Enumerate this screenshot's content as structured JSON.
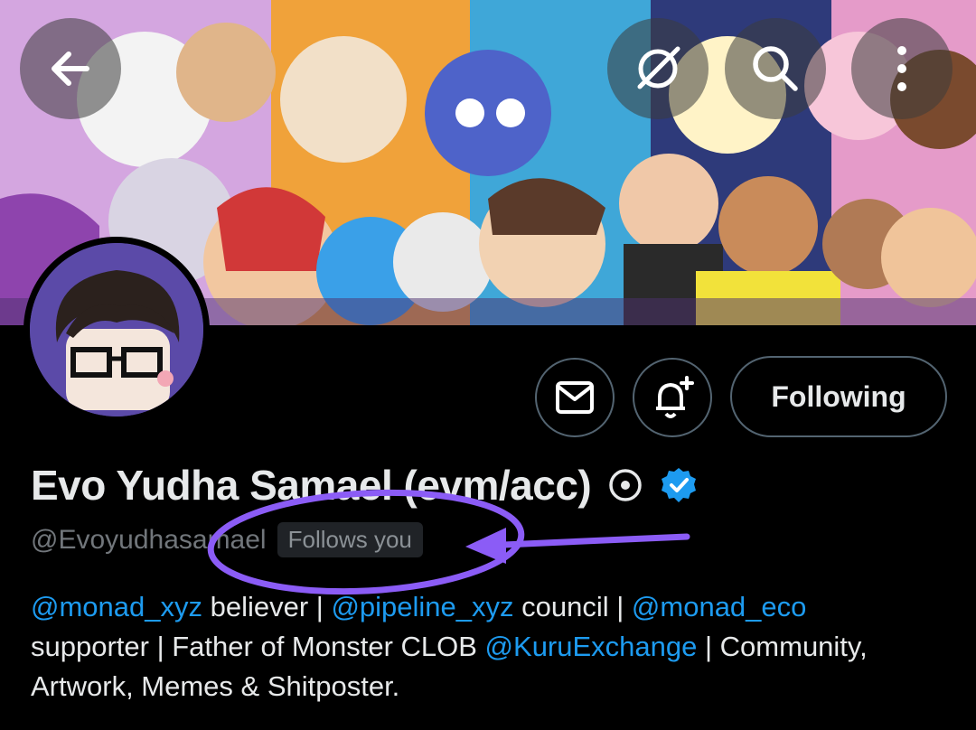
{
  "header": {
    "back_icon": "arrow-left-icon",
    "grok_icon": "grok-icon",
    "search_icon": "search-icon",
    "more_icon": "more-vertical-icon"
  },
  "profile": {
    "name": "Evo Yudha Samael (evm/acc)",
    "handle": "@Evoyudhasamael",
    "follows_you": "Follows you",
    "verified_color": "#1d9bf0",
    "bio": {
      "line1": [
        {
          "text": "@monad_xyz",
          "mention": true
        },
        {
          "text": " believer | ",
          "mention": false
        },
        {
          "text": "@pipeline_xyz",
          "mention": true
        },
        {
          "text": " council | ",
          "mention": false
        },
        {
          "text": "@monad_eco",
          "mention": true
        }
      ],
      "line2": [
        {
          "text": "supporter | Father of Monster CLOB ",
          "mention": false
        },
        {
          "text": "@KuruExchange",
          "mention": true
        },
        {
          "text": " | Community,",
          "mention": false
        }
      ],
      "line3": [
        {
          "text": "Artwork, Memes & Shitposter.",
          "mention": false
        }
      ]
    }
  },
  "actions": {
    "message_icon": "mail-icon",
    "notify_icon": "bell-plus-icon",
    "following_label": "Following"
  },
  "annotation": {
    "color": "#8b5cf6"
  }
}
